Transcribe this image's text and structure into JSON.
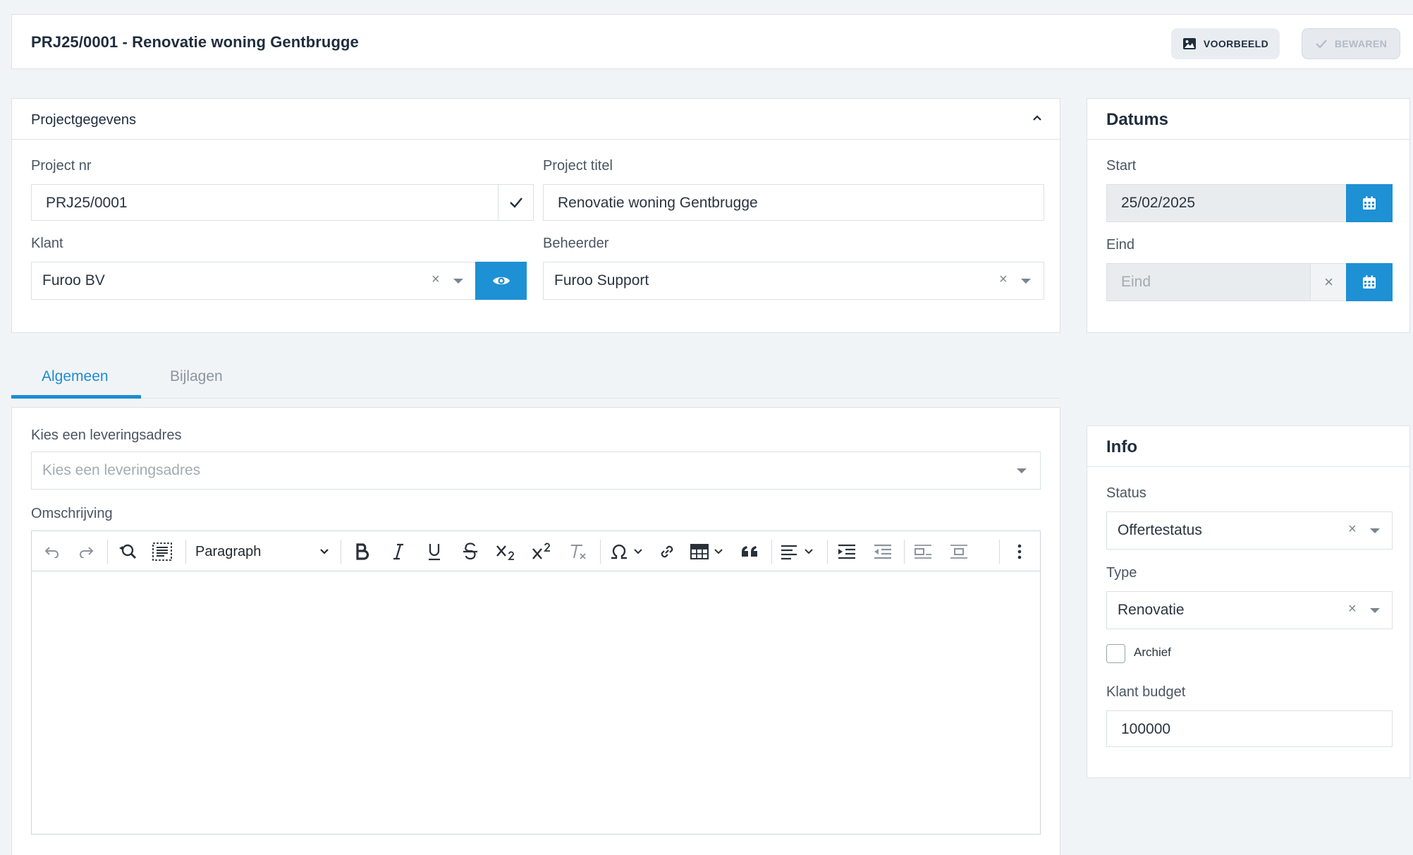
{
  "header": {
    "title": "PRJ25/0001 - Renovatie woning Gentbrugge",
    "preview_label": "VOORBEELD",
    "save_label": "BEWAREN"
  },
  "project": {
    "title": "Projectgegevens",
    "project_nr_label": "Project nr",
    "project_nr_value": "PRJ25/0001",
    "project_titel_label": "Project titel",
    "project_titel_value": "Renovatie woning Gentbrugge",
    "klant_label": "Klant",
    "klant_value": "Furoo BV",
    "beheerder_label": "Beheerder",
    "beheerder_value": "Furoo Support"
  },
  "datums": {
    "title": "Datums",
    "start_label": "Start",
    "start_value": "25/02/2025",
    "eind_label": "Eind",
    "eind_placeholder": "Eind"
  },
  "tabs": [
    {
      "label": "Algemeen",
      "active": true
    },
    {
      "label": "Bijlagen",
      "active": false
    }
  ],
  "main": {
    "leveringsadres_label": "Kies een leveringsadres",
    "leveringsadres_placeholder": "Kies een leveringsadres",
    "omschrijving_label": "Omschrijving",
    "paragraph_label": "Paragraph"
  },
  "info": {
    "title": "Info",
    "status_label": "Status",
    "status_value": "Offertestatus",
    "type_label": "Type",
    "type_value": "Renovatie",
    "archief_label": "Archief",
    "archief_checked": false,
    "budget_label": "Klant budget",
    "budget_value": "100000"
  },
  "common": {
    "clear_symbol": "×"
  },
  "colors": {
    "accent": "#1e90d4",
    "background": "#f1f4f7"
  }
}
